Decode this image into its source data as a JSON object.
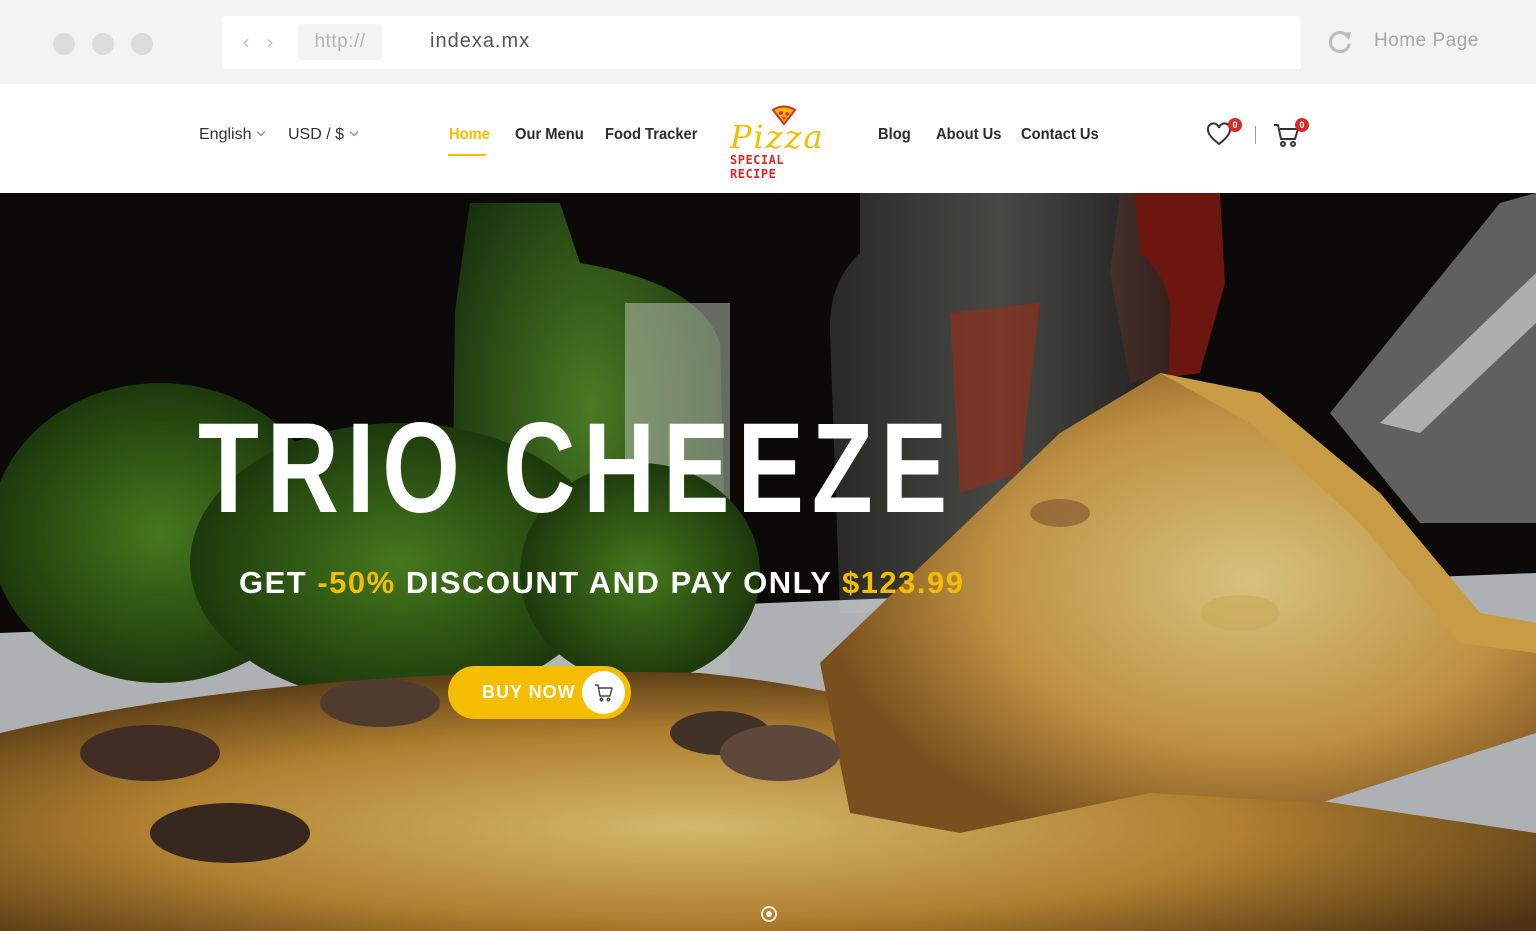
{
  "browser": {
    "protocol": "http://",
    "url": "indexa.mx",
    "home_label": "Home Page"
  },
  "header": {
    "language": "English",
    "currency": "USD / $",
    "menu": [
      "Home",
      "Our Menu",
      "Food Tracker",
      "Blog",
      "About Us",
      "Contact Us"
    ],
    "active_menu": "Home",
    "logo": {
      "script": "Pizza",
      "subtitle": "SPECIAL RECIPE"
    },
    "wishlist_count": "0",
    "cart_count": "0"
  },
  "hero": {
    "title": "TRIO CHEEZE",
    "subtitle_prefix": "GET ",
    "subtitle_discount": "-50%",
    "subtitle_middle": " DISCOUNT AND PAY ONLY ",
    "subtitle_price": "$123.99",
    "button_label": "BUY NOW"
  },
  "colors": {
    "accent": "#f5bd00",
    "badge": "#d62b2b",
    "chrome_bg": "#f3f3f3"
  },
  "icons": [
    "back-arrow-icon",
    "forward-arrow-icon",
    "reload-icon",
    "heart-icon",
    "cart-icon",
    "pizza-slice-icon"
  ]
}
